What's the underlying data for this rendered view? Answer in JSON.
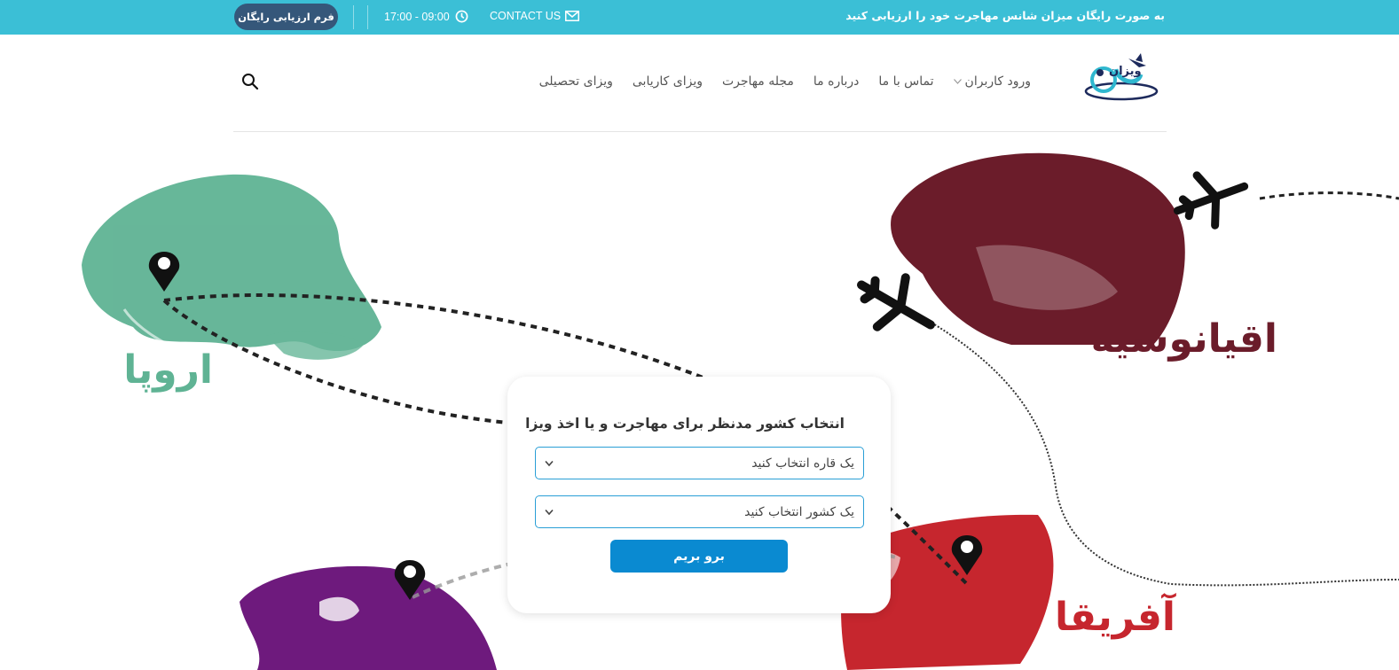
{
  "topbar": {
    "promo": "به صورت رایگان میزان شانس مهاجرت خود را ارزیابی کنید",
    "contact_label": "CONTACT US",
    "hours": "09:00 - 17:00",
    "free_form_button": "فرم ارزیابی رایگان"
  },
  "header": {
    "logo_text": "ویزان",
    "nav": [
      {
        "label": "ویزای تحصیلی"
      },
      {
        "label": "ویزای کاریابی"
      },
      {
        "label": "مجله مهاجرت"
      },
      {
        "label": "درباره ما"
      },
      {
        "label": "تماس با ما"
      },
      {
        "label": "ورود کاربران"
      }
    ]
  },
  "hero": {
    "labels": {
      "europe": "اروپا",
      "oceania": "اقیانوسیه",
      "africa": "آفریقا"
    },
    "colors": {
      "europe": "#5fb394",
      "oceania": "#6b1c2a",
      "africa": "#c6262e",
      "america": "#6e1a7d",
      "route": "#222222"
    }
  },
  "form": {
    "title": "انتخاب کشور مدنظر برای مهاجرت و یا اخذ ویزا",
    "continent_select": "یک قاره انتخاب کنید",
    "country_select": "یک کشور انتخاب کنید",
    "submit": "برو بریم"
  },
  "colors": {
    "topbar": "#3bbfd6",
    "button_dark": "#35577a",
    "accent": "#0a8ad1"
  }
}
